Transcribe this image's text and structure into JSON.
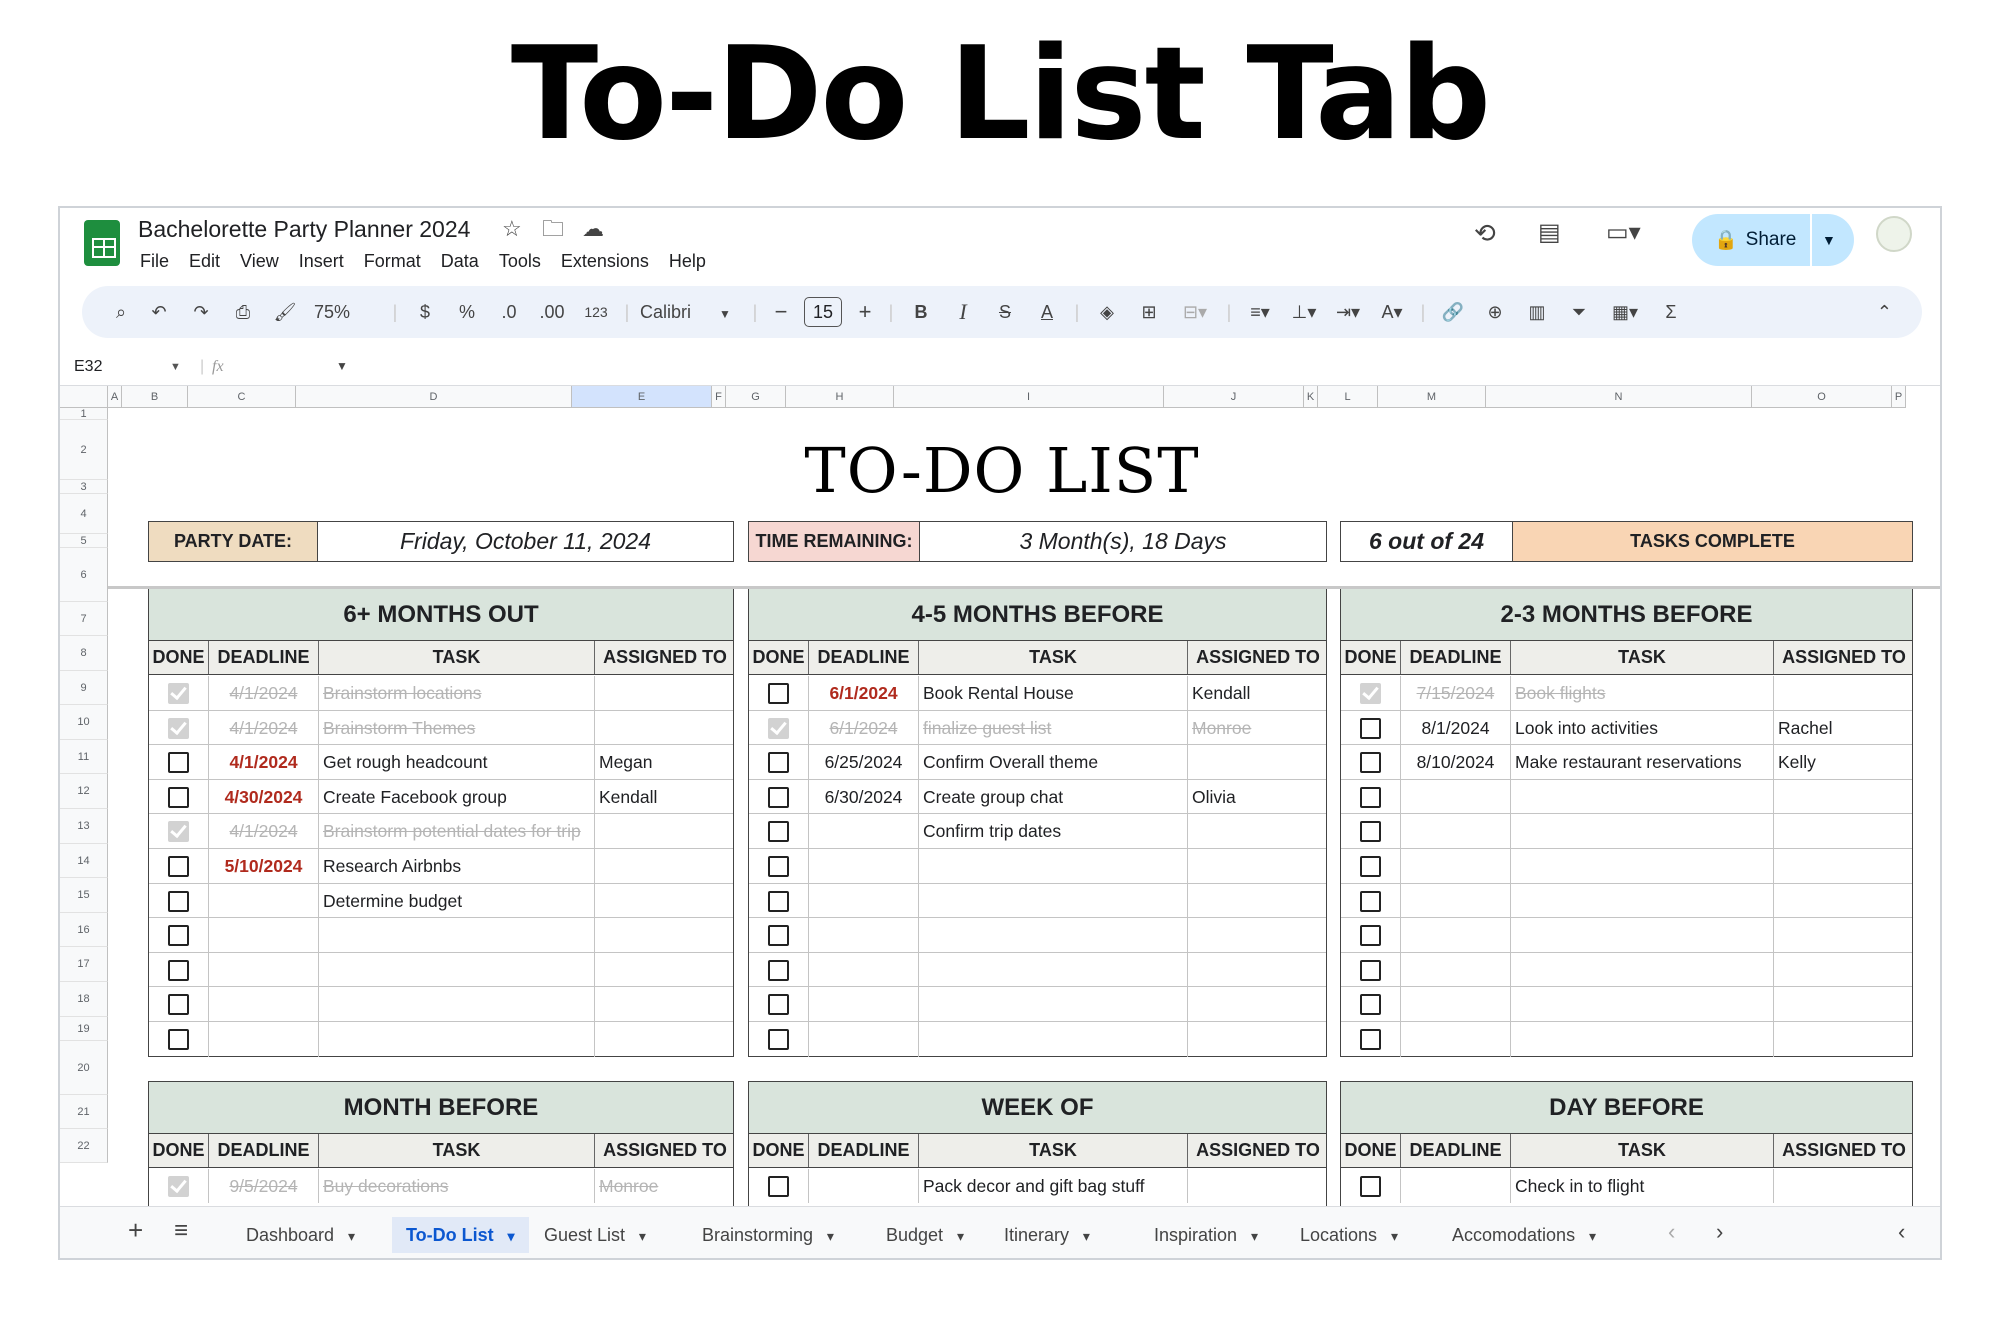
{
  "hero_title": "To-Do List Tab",
  "doc_title": "Bachelorette Party Planner 2024",
  "menu": [
    "File",
    "Edit",
    "View",
    "Insert",
    "Format",
    "Data",
    "Tools",
    "Extensions",
    "Help"
  ],
  "toolbar": {
    "zoom": "75%",
    "currency": "$",
    "percent": "%",
    "dec_less": ".0",
    "dec_more": ".00",
    "number_fmt": "123",
    "font": "Calibri",
    "font_size": "15"
  },
  "share_label": "Share",
  "name_box": "E32",
  "fx": "fx",
  "columns": [
    "A",
    "B",
    "C",
    "D",
    "E",
    "F",
    "G",
    "H",
    "I",
    "J",
    "K",
    "L",
    "M",
    "N",
    "O",
    "P"
  ],
  "rows": [
    "1",
    "2",
    "3",
    "4",
    "5",
    "6",
    "7",
    "8",
    "9",
    "10",
    "11",
    "12",
    "13",
    "14",
    "15",
    "16",
    "17",
    "18",
    "19",
    "20",
    "21",
    "22"
  ],
  "sheet_title": "TO-DO LIST",
  "party_date_label": "PARTY DATE:",
  "party_date": "Friday, October 11, 2024",
  "time_remaining_label": "TIME REMAINING:",
  "time_remaining": "3 Month(s), 18 Days",
  "progress_count": "6 out of 24",
  "progress_label": "TASKS COMPLETE",
  "headers": {
    "done": "DONE",
    "deadline": "DEADLINE",
    "task": "TASK",
    "assigned": "ASSIGNED TO"
  },
  "panels": [
    {
      "title": "6+ MONTHS OUT",
      "rows": [
        {
          "done": true,
          "deadline": "4/1/2024",
          "task": "Brainstorm locations",
          "assigned": ""
        },
        {
          "done": true,
          "deadline": "4/1/2024",
          "task": "Brainstorm Themes",
          "assigned": ""
        },
        {
          "done": false,
          "deadline": "4/1/2024",
          "late": true,
          "task": "Get rough headcount",
          "assigned": "Megan"
        },
        {
          "done": false,
          "deadline": "4/30/2024",
          "late": true,
          "task": "Create Facebook group",
          "assigned": "Kendall"
        },
        {
          "done": true,
          "deadline": "4/1/2024",
          "task": "Brainstorm potential dates for trip",
          "assigned": ""
        },
        {
          "done": false,
          "deadline": "5/10/2024",
          "late": true,
          "task": "Research Airbnbs",
          "assigned": ""
        },
        {
          "done": false,
          "deadline": "",
          "task": "Determine budget",
          "assigned": ""
        },
        {
          "done": false,
          "deadline": "",
          "task": "",
          "assigned": ""
        },
        {
          "done": false,
          "deadline": "",
          "task": "",
          "assigned": ""
        },
        {
          "done": false,
          "deadline": "",
          "task": "",
          "assigned": ""
        },
        {
          "done": false,
          "deadline": "",
          "task": "",
          "assigned": ""
        }
      ]
    },
    {
      "title": "4-5 MONTHS BEFORE",
      "rows": [
        {
          "done": false,
          "deadline": "6/1/2024",
          "late": true,
          "task": "Book Rental House",
          "assigned": "Kendall"
        },
        {
          "done": true,
          "deadline": "6/1/2024",
          "task": "finalize guest list",
          "assigned": "Monroe"
        },
        {
          "done": false,
          "deadline": "6/25/2024",
          "task": "Confirm Overall theme",
          "assigned": ""
        },
        {
          "done": false,
          "deadline": "6/30/2024",
          "task": "Create group chat",
          "assigned": "Olivia"
        },
        {
          "done": false,
          "deadline": "",
          "task": "Confirm trip dates",
          "assigned": ""
        },
        {
          "done": false,
          "deadline": "",
          "task": "",
          "assigned": ""
        },
        {
          "done": false,
          "deadline": "",
          "task": "",
          "assigned": ""
        },
        {
          "done": false,
          "deadline": "",
          "task": "",
          "assigned": ""
        },
        {
          "done": false,
          "deadline": "",
          "task": "",
          "assigned": ""
        },
        {
          "done": false,
          "deadline": "",
          "task": "",
          "assigned": ""
        },
        {
          "done": false,
          "deadline": "",
          "task": "",
          "assigned": ""
        }
      ]
    },
    {
      "title": "2-3 MONTHS BEFORE",
      "rows": [
        {
          "done": true,
          "deadline": "7/15/2024",
          "task": "Book flights",
          "assigned": ""
        },
        {
          "done": false,
          "deadline": "8/1/2024",
          "task": "Look into activities",
          "assigned": "Rachel"
        },
        {
          "done": false,
          "deadline": "8/10/2024",
          "task": "Make restaurant reservations",
          "assigned": "Kelly"
        },
        {
          "done": false,
          "deadline": "",
          "task": "",
          "assigned": ""
        },
        {
          "done": false,
          "deadline": "",
          "task": "",
          "assigned": ""
        },
        {
          "done": false,
          "deadline": "",
          "task": "",
          "assigned": ""
        },
        {
          "done": false,
          "deadline": "",
          "task": "",
          "assigned": ""
        },
        {
          "done": false,
          "deadline": "",
          "task": "",
          "assigned": ""
        },
        {
          "done": false,
          "deadline": "",
          "task": "",
          "assigned": ""
        },
        {
          "done": false,
          "deadline": "",
          "task": "",
          "assigned": ""
        },
        {
          "done": false,
          "deadline": "",
          "task": "",
          "assigned": ""
        }
      ]
    },
    {
      "title": "MONTH BEFORE",
      "rows": [
        {
          "done": true,
          "deadline": "9/5/2024",
          "task": "Buy decorations",
          "assigned": "Monroe"
        }
      ]
    },
    {
      "title": "WEEK OF",
      "rows": [
        {
          "done": false,
          "deadline": "",
          "task": "Pack decor and gift bag stuff",
          "assigned": ""
        }
      ]
    },
    {
      "title": "DAY BEFORE",
      "rows": [
        {
          "done": false,
          "deadline": "",
          "task": "Check in to flight",
          "assigned": ""
        }
      ]
    }
  ],
  "sheet_tabs": [
    "Dashboard",
    "To-Do List",
    "Guest List",
    "Brainstorming",
    "Budget",
    "Itinerary",
    "Inspiration",
    "Locations",
    "Accomodations"
  ],
  "active_tab": "To-Do List",
  "colors": {
    "header_green": "#d9e4dc",
    "party_date_bg": "#efdcc0",
    "time_remaining_bg": "#f6d7d2",
    "tasks_complete_bg": "#f9d5b4",
    "share_bg": "#c2e7ff",
    "late_red": "#b02a1d",
    "active_tab": "#0b57d0"
  }
}
